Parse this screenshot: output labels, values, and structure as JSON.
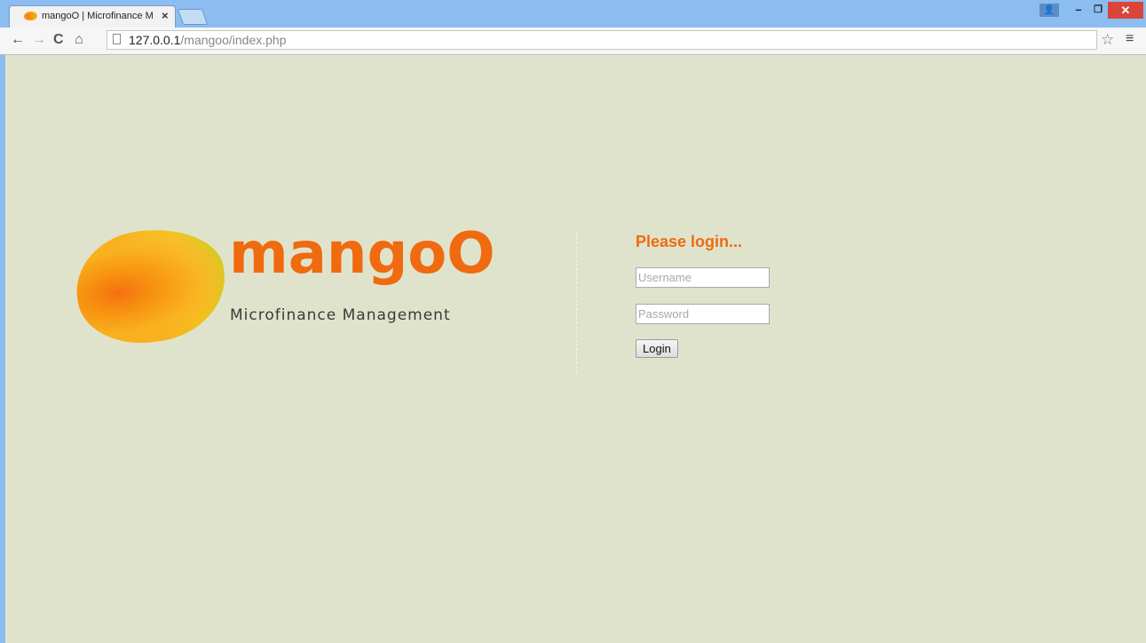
{
  "browser": {
    "tab_title": "mangoO | Microfinance M",
    "tab_close": "×",
    "url_host": "127.0.0.1",
    "url_path": "/mangoo/index.php",
    "nav": {
      "back": "←",
      "forward": "→",
      "reload": "C",
      "home": "⌂"
    },
    "bookmark_star": "☆",
    "menu": "≡",
    "window": {
      "user": "👤",
      "minimize": "–",
      "maximize": "❐",
      "close": "✕"
    }
  },
  "logo": {
    "word": "mangoO",
    "subtitle": "Microfinance Management"
  },
  "login": {
    "title": "Please login...",
    "username_placeholder": "Username",
    "username_value": "",
    "password_placeholder": "Password",
    "password_value": "",
    "button": "Login"
  },
  "colors": {
    "page_background": "#e0e3cc",
    "accent_orange": "#f06a0f",
    "chrome_blue": "#8bbdf0"
  }
}
